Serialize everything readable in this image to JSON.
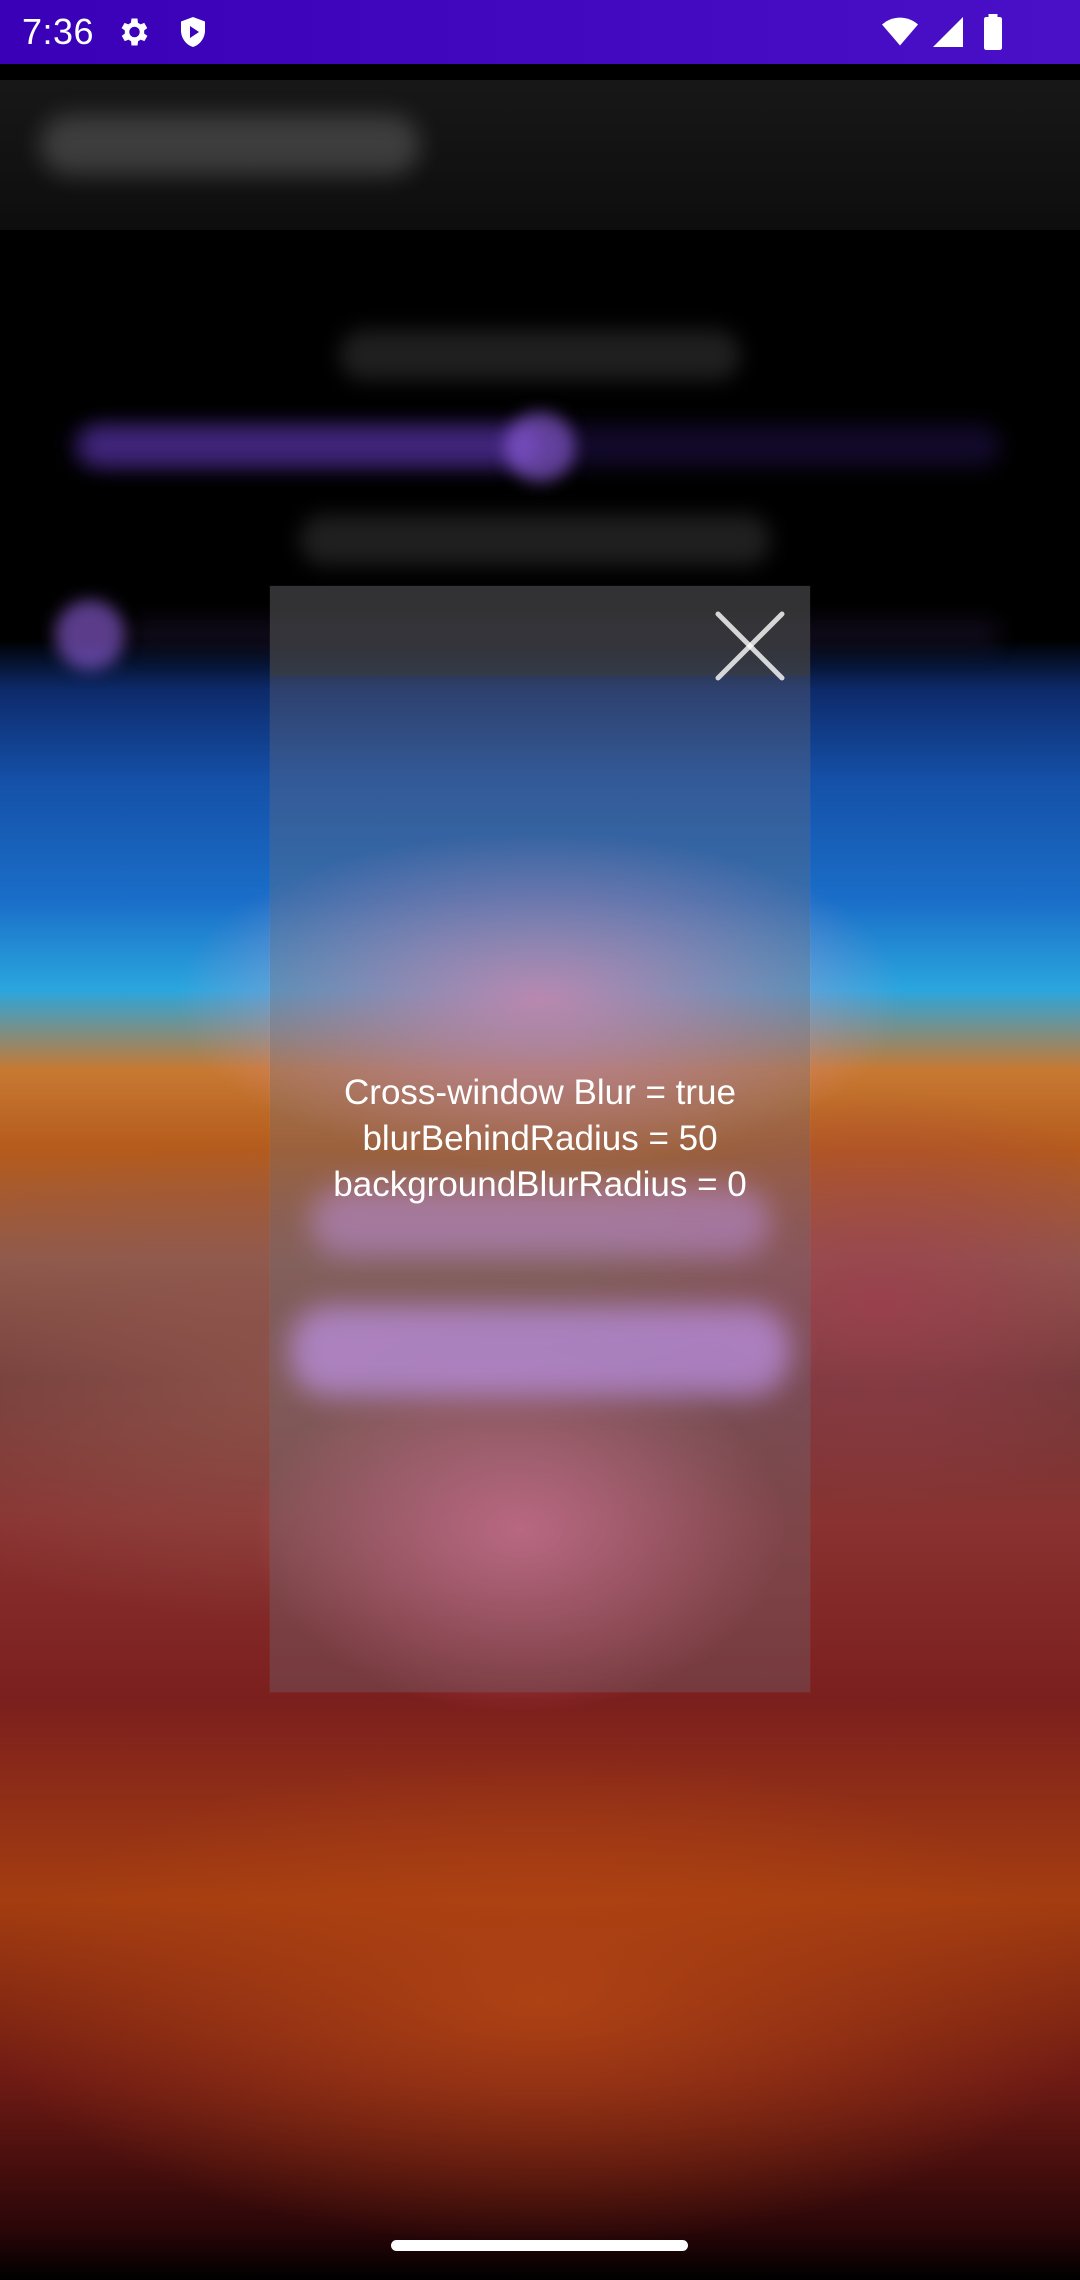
{
  "status_bar": {
    "time": "7:36",
    "icons": [
      "settings-gear-icon",
      "shield-icon",
      "wifi-icon",
      "signal-icon",
      "battery-icon"
    ]
  },
  "dialog": {
    "close_icon": "close-icon",
    "lines": [
      "Cross-window Blur = true",
      "blurBehindRadius = 50",
      "backgroundBlurRadius = 0"
    ]
  },
  "colors": {
    "status_bar": "#3a00b8",
    "accent_purple": "#c396f5",
    "text": "#ffffff"
  }
}
